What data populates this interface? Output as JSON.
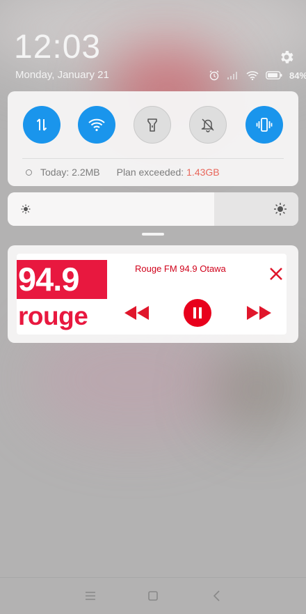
{
  "status": {
    "time": "12:03",
    "date": "Monday, January 21",
    "battery": "84%"
  },
  "quick_settings": {
    "toggles": [
      {
        "name": "mobile-data",
        "icon": "data-arrows-icon",
        "state": "on"
      },
      {
        "name": "wifi",
        "icon": "wifi-icon",
        "state": "on"
      },
      {
        "name": "flashlight",
        "icon": "flashlight-icon",
        "state": "off"
      },
      {
        "name": "mute",
        "icon": "bell-off-icon",
        "state": "off"
      },
      {
        "name": "vibrate",
        "icon": "vibrate-icon",
        "state": "on"
      }
    ],
    "data_usage": {
      "today": "Today: 2.2MB",
      "plan_label": "Plan exceeded:",
      "plan_value": "1.43GB"
    }
  },
  "brightness": {
    "level": 0.71
  },
  "media": {
    "logo_top": "94.9",
    "logo_bottom": "rouge",
    "station": "Rouge FM 94.9 Otawa"
  },
  "colors": {
    "toggle_on": "#1a95ec",
    "brand_red": "#e8183f",
    "plan_exceeded": "#e8665a"
  }
}
